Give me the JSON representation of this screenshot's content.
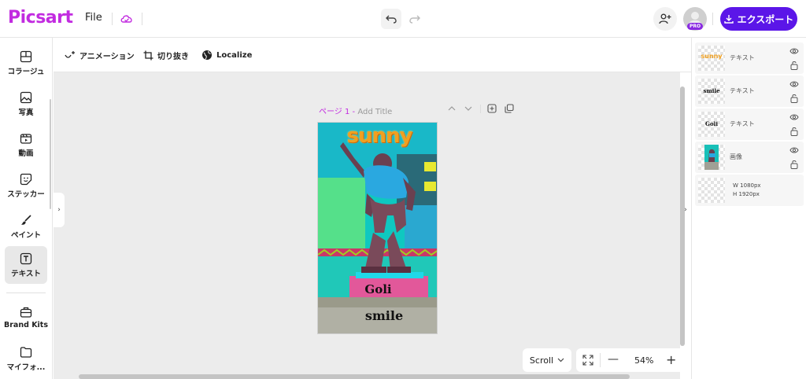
{
  "header": {
    "logo": "Picsart",
    "file_label": "File",
    "export_label": "エクスポート",
    "pro_badge": "PRO"
  },
  "sidebar": {
    "items": [
      {
        "label": "コラージュ",
        "icon": "collage-icon"
      },
      {
        "label": "写真",
        "icon": "photo-icon"
      },
      {
        "label": "動画",
        "icon": "video-icon"
      },
      {
        "label": "ステッカー",
        "icon": "sticker-icon"
      },
      {
        "label": "ペイント",
        "icon": "brush-icon"
      },
      {
        "label": "テキスト",
        "icon": "text-icon",
        "active": true
      },
      {
        "label": "Brand Kits",
        "icon": "brand-kit-icon"
      },
      {
        "label": "マイフォ...",
        "icon": "folder-icon"
      }
    ]
  },
  "toolbar": {
    "animation": "アニメーション",
    "crop": "切り抜き",
    "localize": "Localize"
  },
  "page": {
    "label": "ページ 1 -",
    "title_placeholder": "Add Title"
  },
  "artboard": {
    "top_text": "sunny",
    "text_mid": "Goli",
    "text_bottom": "smile"
  },
  "zoom": {
    "mode": "Scroll",
    "percent": "54%"
  },
  "layers": [
    {
      "name": "テキスト",
      "thumb_text": "sunny"
    },
    {
      "name": "テキスト",
      "thumb_text": "smile"
    },
    {
      "name": "テキスト",
      "thumb_text": "Goli"
    },
    {
      "name": "画像",
      "thumb_text": ""
    }
  ],
  "canvas_size": {
    "w_label": "W",
    "w_value": "1080px",
    "h_label": "H",
    "h_value": "1920px"
  },
  "colors": {
    "brand": "#c22be0",
    "export": "#5b16e8"
  }
}
